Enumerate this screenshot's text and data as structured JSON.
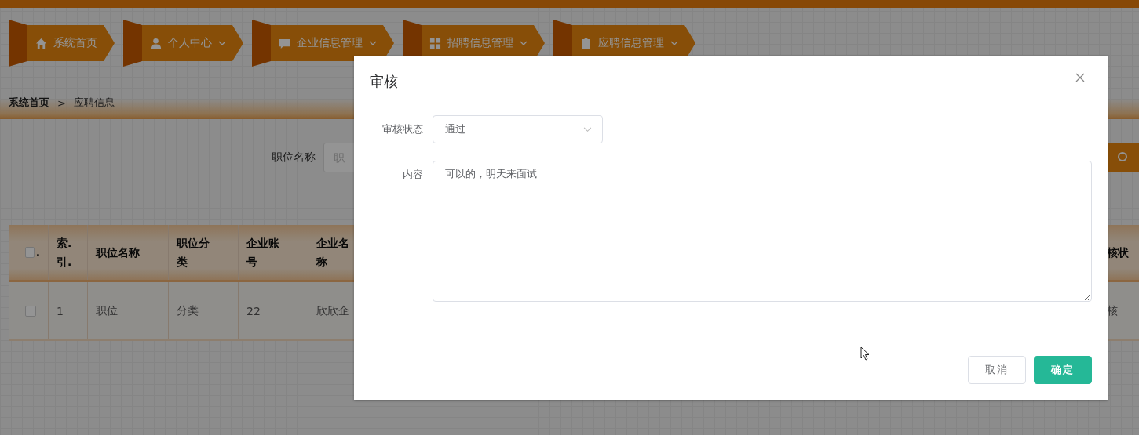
{
  "nav": [
    {
      "label": "系统首页",
      "has_caret": false
    },
    {
      "label": "个人中心",
      "has_caret": true
    },
    {
      "label": "企业信息管理",
      "has_caret": true
    },
    {
      "label": "招聘信息管理",
      "has_caret": true
    },
    {
      "label": "应聘信息管理",
      "has_caret": true
    }
  ],
  "breadcrumb": [
    "系统首页",
    "应聘信息"
  ],
  "breadcrumb_separator": ">",
  "search": {
    "label": "职位名称",
    "placeholder": "职"
  },
  "table": {
    "header_checkbox": {
      "checked": false
    },
    "header_mark": ".",
    "columns": [
      "索.引.",
      "职位名称",
      "职位分类",
      "企业账号",
      "企业名称",
      "核状"
    ],
    "rows": [
      {
        "checked": false,
        "cells": [
          "1",
          "职位",
          "分类",
          "22",
          "欣欣企",
          "核"
        ]
      }
    ]
  },
  "dialog": {
    "title": "审核",
    "fields": [
      {
        "kind": "select",
        "label": "审核状态",
        "value": "通过"
      },
      {
        "kind": "textarea",
        "label": "内容",
        "value": "可以的，明天来面试"
      }
    ],
    "buttons": [
      {
        "kind": "default",
        "label": "取消"
      },
      {
        "kind": "primary",
        "label": "确定"
      }
    ]
  }
}
